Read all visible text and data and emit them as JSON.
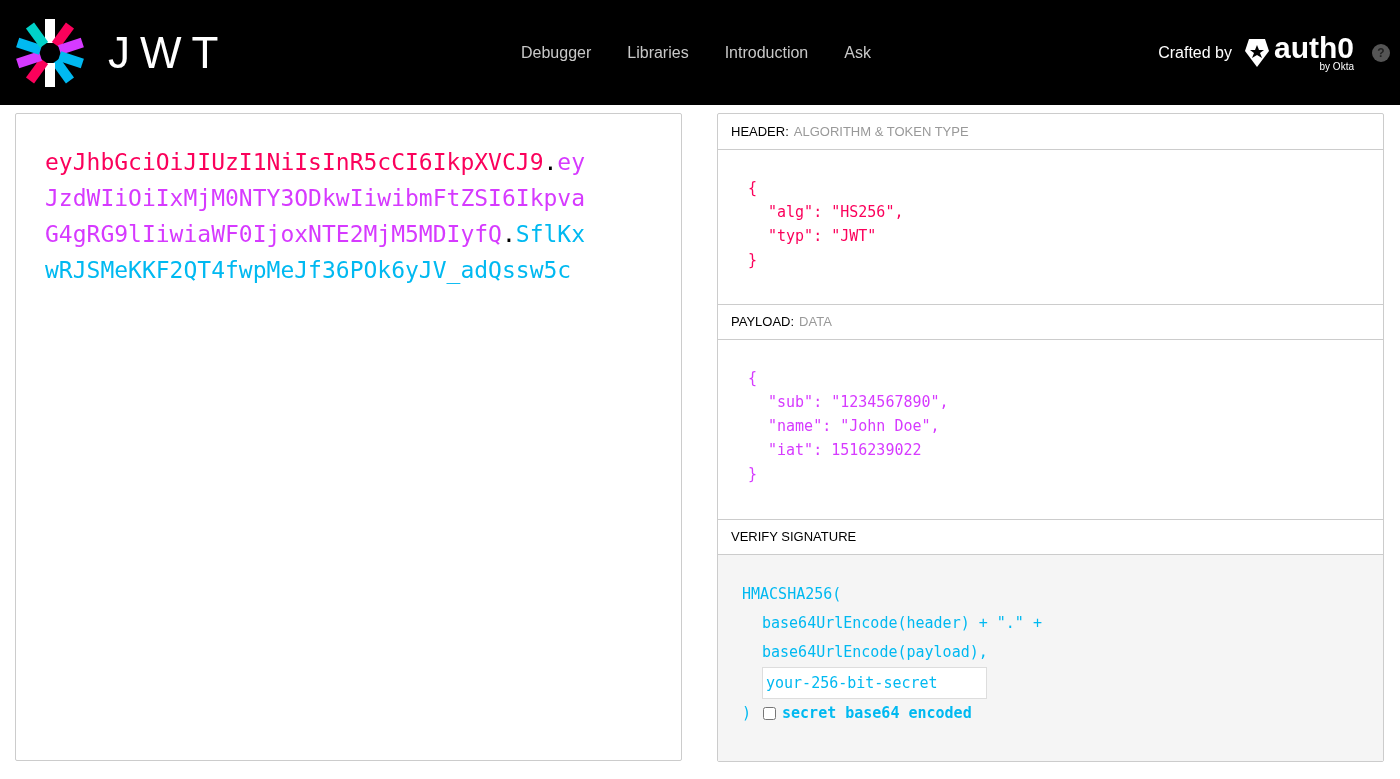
{
  "navbar": {
    "logo_text": "JWT",
    "links": [
      {
        "label": "Debugger"
      },
      {
        "label": "Libraries"
      },
      {
        "label": "Introduction"
      },
      {
        "label": "Ask"
      }
    ],
    "crafted_by": "Crafted by",
    "brand": "auth0",
    "brand_sub": "by Okta",
    "help": "?"
  },
  "encoded": {
    "parts": [
      {
        "text": "eyJhbGciOiJIUzI1NiIsInR5cCI6IkpXVCJ9",
        "color": "#fb015b"
      },
      {
        "text": "eyJzdWIiOiIxMjM0NTY3ODkwIiwibmFtZSI6IkpvaG4gRG9lIiwiaWF0IjoxNTE2MjM5MDIyfQ",
        "color": "#d63aff"
      },
      {
        "text": "SflKxwRJSMeKKF2QT4fwpMeJf36POk6yJV_adQssw5c",
        "color": "#00b9f1"
      }
    ],
    "separator": "."
  },
  "sections": [
    {
      "kind": "json",
      "title": "HEADER:",
      "subtitle": "ALGORITHM & TOKEN TYPE",
      "color": "#fb015b",
      "open": "{",
      "entries": [
        "\"alg\": \"HS256\",",
        "\"typ\": \"JWT\""
      ],
      "close": "}"
    },
    {
      "kind": "json",
      "title": "PAYLOAD:",
      "subtitle": "DATA",
      "color": "#d63aff",
      "open": "{",
      "entries": [
        "\"sub\": \"1234567890\",",
        "\"name\": \"John Doe\",",
        "\"iat\": 1516239022"
      ],
      "close": "}"
    },
    {
      "kind": "verify",
      "title": "VERIFY SIGNATURE",
      "color": "#00b9f1",
      "open": "HMACSHA256(",
      "entries": [
        "base64UrlEncode(header) + \".\" +",
        "base64UrlEncode(payload),"
      ],
      "secret": {
        "value": "your-256-bit-secret"
      },
      "close": ")",
      "checkbox": {
        "label": "secret base64 encoded",
        "checked": false
      }
    }
  ]
}
